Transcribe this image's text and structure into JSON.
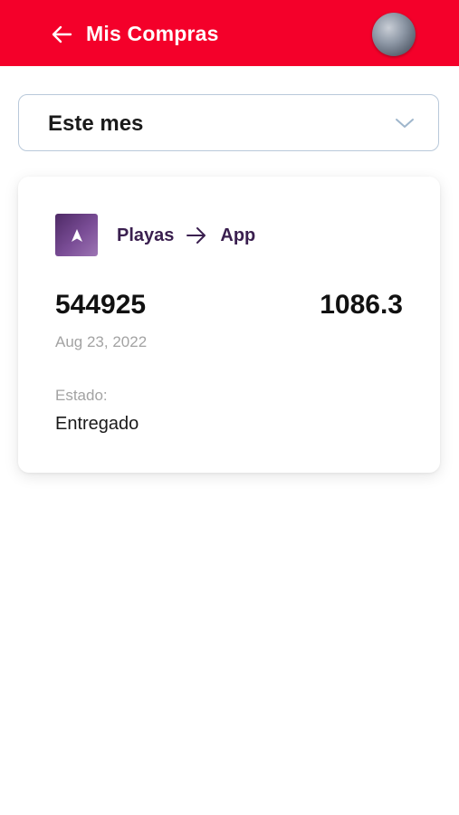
{
  "header": {
    "title": "Mis Compras",
    "back_icon": "arrow-left-icon",
    "background_color": "#f4002a"
  },
  "filter": {
    "selected": "Este mes",
    "icon": "chevron-down-icon"
  },
  "order": {
    "origin": "Playas",
    "destination": "App",
    "logo_icon": "navigation-arrow-icon",
    "id": "544925",
    "amount": "1086.3",
    "date": "Aug 23, 2022",
    "status_label": "Estado:",
    "status": "Entregado"
  }
}
